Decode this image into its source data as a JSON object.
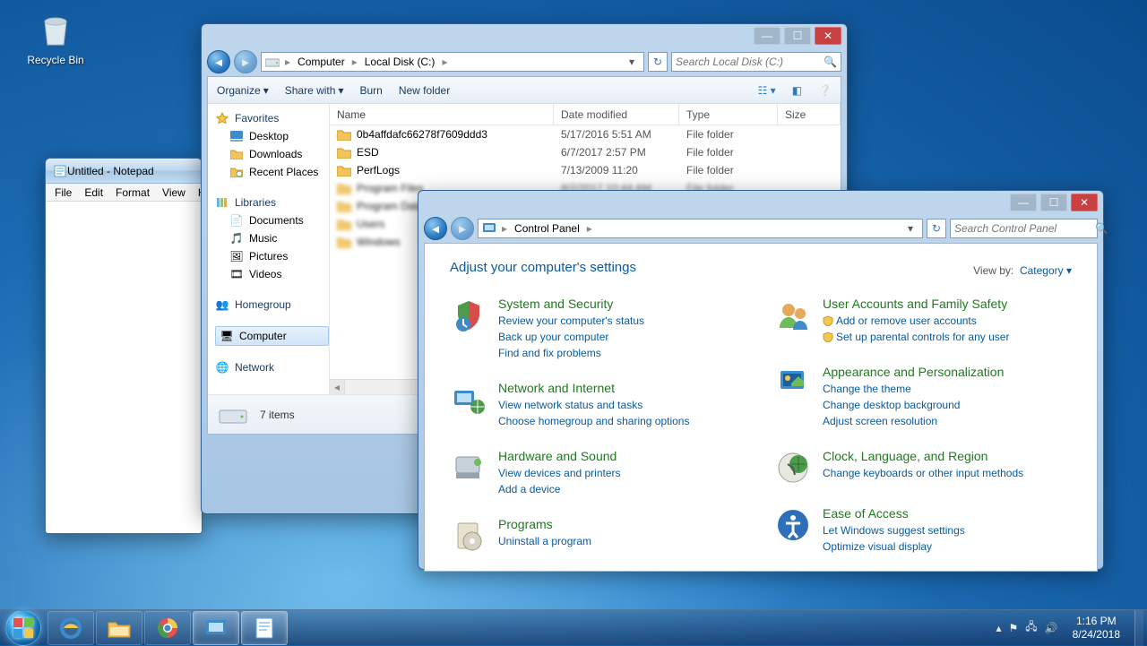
{
  "desktop": {
    "recycle_bin": "Recycle Bin"
  },
  "notepad": {
    "title": "Untitled - Notepad",
    "menu": [
      "File",
      "Edit",
      "Format",
      "View",
      "Help"
    ]
  },
  "explorer": {
    "breadcrumb": [
      "Computer",
      "Local Disk (C:)"
    ],
    "search_placeholder": "Search Local Disk (C:)",
    "toolbar": {
      "organize": "Organize",
      "share": "Share with",
      "burn": "Burn",
      "newfolder": "New folder"
    },
    "columns": {
      "name": "Name",
      "date": "Date modified",
      "type": "Type",
      "size": "Size"
    },
    "nav": {
      "favorites": {
        "label": "Favorites",
        "items": [
          "Desktop",
          "Downloads",
          "Recent Places"
        ]
      },
      "libraries": {
        "label": "Libraries",
        "items": [
          "Documents",
          "Music",
          "Pictures",
          "Videos"
        ]
      },
      "homegroup": "Homegroup",
      "computer": "Computer",
      "network": "Network"
    },
    "files": [
      {
        "name": "0b4affdafc66278f7609ddd3",
        "date": "5/17/2016 5:51 AM",
        "type": "File folder",
        "blur": false
      },
      {
        "name": "ESD",
        "date": "6/7/2017 2:57 PM",
        "type": "File folder",
        "blur": false
      },
      {
        "name": "PerfLogs",
        "date": "7/13/2009 11:20",
        "type": "File folder",
        "blur": false
      },
      {
        "name": "Program Files",
        "date": "8/2/2017 10:44 AM",
        "type": "File folder",
        "blur": true
      },
      {
        "name": "Program Data",
        "date": "",
        "type": "",
        "blur": true
      },
      {
        "name": "Users",
        "date": "",
        "type": "",
        "blur": true
      },
      {
        "name": "Windows",
        "date": "",
        "type": "",
        "blur": true
      }
    ],
    "status": "7 items"
  },
  "cp": {
    "breadcrumb": [
      "Control Panel"
    ],
    "search_placeholder": "Search Control Panel",
    "title": "Adjust your computer's settings",
    "view_label": "View by:",
    "view_value": "Category",
    "cats": {
      "sys": {
        "title": "System and Security",
        "links": [
          "Review your computer's status",
          "Back up your computer",
          "Find and fix problems"
        ]
      },
      "net": {
        "title": "Network and Internet",
        "links": [
          "View network status and tasks",
          "Choose homegroup and sharing options"
        ]
      },
      "hw": {
        "title": "Hardware and Sound",
        "links": [
          "View devices and printers",
          "Add a device"
        ]
      },
      "prog": {
        "title": "Programs",
        "links": [
          "Uninstall a program"
        ]
      },
      "user": {
        "title": "User Accounts and Family Safety",
        "links": [
          "Add or remove user accounts",
          "Set up parental controls for any user"
        ],
        "shield": [
          0,
          1
        ]
      },
      "app": {
        "title": "Appearance and Personalization",
        "links": [
          "Change the theme",
          "Change desktop background",
          "Adjust screen resolution"
        ]
      },
      "clk": {
        "title": "Clock, Language, and Region",
        "links": [
          "Change keyboards or other input methods"
        ]
      },
      "ease": {
        "title": "Ease of Access",
        "links": [
          "Let Windows suggest settings",
          "Optimize visual display"
        ]
      }
    }
  },
  "taskbar": {
    "time": "1:16 PM",
    "date": "8/24/2018"
  }
}
